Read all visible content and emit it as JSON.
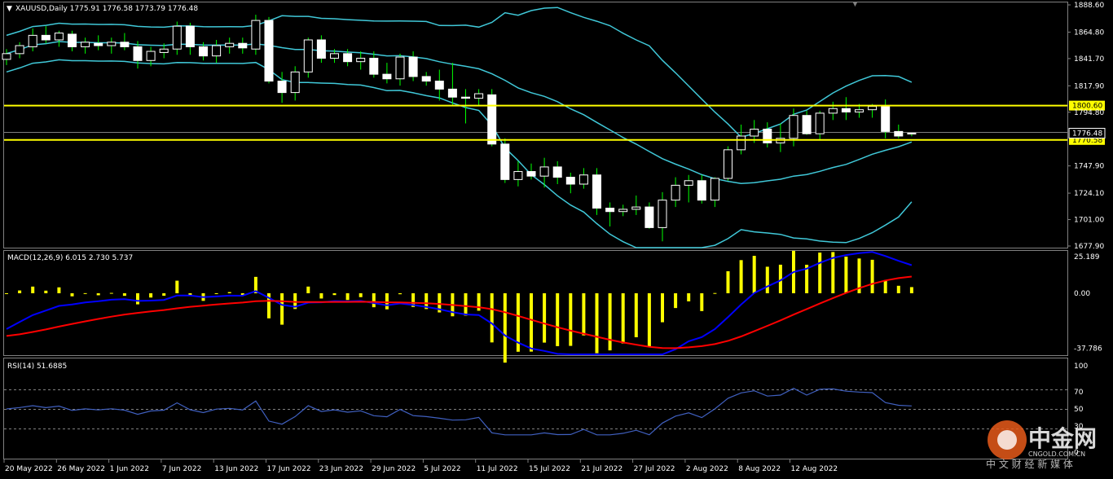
{
  "main": {
    "header": "XAUUSD,Daily  1775.91 1776.58 1773.79 1776.48",
    "y_ticks": [
      "1888.60",
      "1864.80",
      "1841.70",
      "1817.90",
      "1794.80",
      "1747.90",
      "1724.10",
      "1701.00",
      "1677.90"
    ],
    "price_tag": "1776.48",
    "h_lines": [
      {
        "value": 1800.6,
        "label": "1800.60",
        "color": "#ffff00"
      },
      {
        "value": 1770.58,
        "label": "1770.58",
        "color": "#ffff00"
      }
    ]
  },
  "macd": {
    "header": "MACD(12,26,9) 6.015 2.730 5.737",
    "y_ticks": [
      "25.189",
      "0.00",
      "-37.786"
    ]
  },
  "rsi": {
    "header": "RSI(14) 51.6885",
    "y_ticks": [
      "100",
      "70",
      "50",
      "30",
      "0"
    ]
  },
  "x_ticks": [
    "20 May 2022",
    "26 May 2022",
    "1 Jun 2022",
    "7 Jun 2022",
    "13 Jun 2022",
    "17 Jun 2022",
    "23 Jun 2022",
    "29 Jun 2022",
    "5 Jul 2022",
    "11 Jul 2022",
    "15 Jul 2022",
    "21 Jul 2022",
    "27 Jul 2022",
    "2 Aug 2022",
    "8 Aug 2022",
    "12 Aug 2022"
  ],
  "watermark": {
    "brand": "中金网",
    "domain": "CNGOLD.COM.CN",
    "slogan": "中 文 财 经 新 媒 体"
  },
  "colors": {
    "bull": "#ffffff",
    "bear": "#ffffff",
    "wick": "#00ff00",
    "bands": "#40c8d8",
    "macd_hist": "#ffff00",
    "macd_main": "#0000ff",
    "macd_signal": "#ff0000",
    "rsi": "#4060c0",
    "hline": "#ffff00",
    "grid": "#808080"
  },
  "chart_data": {
    "type": "candlestick",
    "symbol": "XAUUSD",
    "timeframe": "Daily",
    "ylim": [
      1677.9,
      1888.6
    ],
    "candles": [
      [
        1841,
        1850,
        1836,
        1846
      ],
      [
        1846,
        1856,
        1842,
        1853
      ],
      [
        1852,
        1868,
        1848,
        1862
      ],
      [
        1862,
        1870,
        1855,
        1858
      ],
      [
        1858,
        1866,
        1852,
        1864
      ],
      [
        1863,
        1866,
        1848,
        1852
      ],
      [
        1852,
        1860,
        1846,
        1856
      ],
      [
        1855,
        1862,
        1849,
        1853
      ],
      [
        1853,
        1860,
        1846,
        1856
      ],
      [
        1856,
        1864,
        1849,
        1852
      ],
      [
        1852,
        1857,
        1833,
        1840
      ],
      [
        1840,
        1852,
        1835,
        1848
      ],
      [
        1847,
        1855,
        1842,
        1850
      ],
      [
        1850,
        1874,
        1845,
        1870
      ],
      [
        1870,
        1873,
        1845,
        1852
      ],
      [
        1852,
        1856,
        1840,
        1844
      ],
      [
        1844,
        1858,
        1838,
        1853
      ],
      [
        1852,
        1860,
        1846,
        1855
      ],
      [
        1855,
        1860,
        1846,
        1851
      ],
      [
        1850,
        1880,
        1845,
        1875
      ],
      [
        1875,
        1878,
        1820,
        1822
      ],
      [
        1822,
        1830,
        1803,
        1812
      ],
      [
        1812,
        1835,
        1805,
        1830
      ],
      [
        1830,
        1860,
        1825,
        1858
      ],
      [
        1858,
        1862,
        1838,
        1842
      ],
      [
        1842,
        1850,
        1838,
        1846
      ],
      [
        1846,
        1850,
        1835,
        1839
      ],
      [
        1839,
        1848,
        1832,
        1842
      ],
      [
        1842,
        1848,
        1825,
        1828
      ],
      [
        1828,
        1838,
        1820,
        1824
      ],
      [
        1824,
        1846,
        1818,
        1843
      ],
      [
        1843,
        1848,
        1822,
        1826
      ],
      [
        1826,
        1830,
        1818,
        1822
      ],
      [
        1822,
        1832,
        1805,
        1815
      ],
      [
        1815,
        1838,
        1800,
        1808
      ],
      [
        1808,
        1815,
        1785,
        1807
      ],
      [
        1807,
        1815,
        1800,
        1811
      ],
      [
        1810,
        1815,
        1765,
        1767
      ],
      [
        1767,
        1772,
        1733,
        1736
      ],
      [
        1736,
        1752,
        1730,
        1743
      ],
      [
        1743,
        1750,
        1736,
        1739
      ],
      [
        1739,
        1755,
        1729,
        1747
      ],
      [
        1747,
        1752,
        1732,
        1738
      ],
      [
        1738,
        1742,
        1724,
        1732
      ],
      [
        1732,
        1746,
        1728,
        1740
      ],
      [
        1740,
        1746,
        1705,
        1711
      ],
      [
        1711,
        1716,
        1695,
        1708
      ],
      [
        1708,
        1714,
        1704,
        1710
      ],
      [
        1710,
        1722,
        1705,
        1712
      ],
      [
        1712,
        1716,
        1693,
        1694
      ],
      [
        1694,
        1725,
        1682,
        1718
      ],
      [
        1718,
        1738,
        1712,
        1731
      ],
      [
        1731,
        1740,
        1716,
        1735
      ],
      [
        1735,
        1740,
        1715,
        1718
      ],
      [
        1718,
        1738,
        1712,
        1737
      ],
      [
        1737,
        1765,
        1735,
        1762
      ],
      [
        1762,
        1784,
        1758,
        1774
      ],
      [
        1774,
        1788,
        1768,
        1780
      ],
      [
        1780,
        1786,
        1764,
        1768
      ],
      [
        1768,
        1785,
        1760,
        1772
      ],
      [
        1772,
        1798,
        1765,
        1792
      ],
      [
        1792,
        1796,
        1775,
        1776
      ],
      [
        1776,
        1796,
        1770,
        1794
      ],
      [
        1794,
        1804,
        1788,
        1798
      ],
      [
        1798,
        1808,
        1788,
        1795
      ],
      [
        1795,
        1802,
        1790,
        1797
      ],
      [
        1797,
        1802,
        1790,
        1800
      ],
      [
        1800,
        1806,
        1772,
        1778
      ],
      [
        1778,
        1784,
        1772,
        1774
      ],
      [
        1775.91,
        1776.58,
        1773.79,
        1776.48
      ]
    ]
  }
}
